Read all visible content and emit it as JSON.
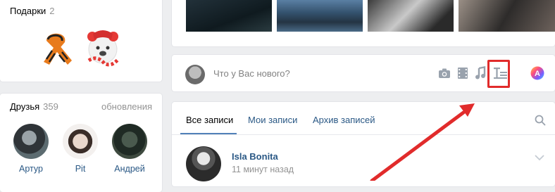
{
  "colors": {
    "link": "#2a5885",
    "muted": "#939393",
    "accent": "#5181b8",
    "highlight": "#e12b2b"
  },
  "gifts": {
    "title": "Подарки",
    "count": "2",
    "items": [
      "ribbon-icon",
      "bear-gift-icon"
    ]
  },
  "friends": {
    "title": "Друзья",
    "count": "359",
    "link": "обновления",
    "items": [
      {
        "name": "Артур"
      },
      {
        "name": "Pit"
      },
      {
        "name": "Андрей"
      }
    ]
  },
  "composer": {
    "placeholder": "Что у Вас нового?",
    "tools": [
      "camera-icon",
      "video-icon",
      "music-icon",
      "article-icon",
      "poster-icon"
    ]
  },
  "feed": {
    "tabs": [
      {
        "label": "Все записи",
        "active": true
      },
      {
        "label": "Мои записи",
        "active": false
      },
      {
        "label": "Архив записей",
        "active": false
      }
    ],
    "post": {
      "author": "Isla Bonita",
      "time": "11 минут назад"
    }
  }
}
